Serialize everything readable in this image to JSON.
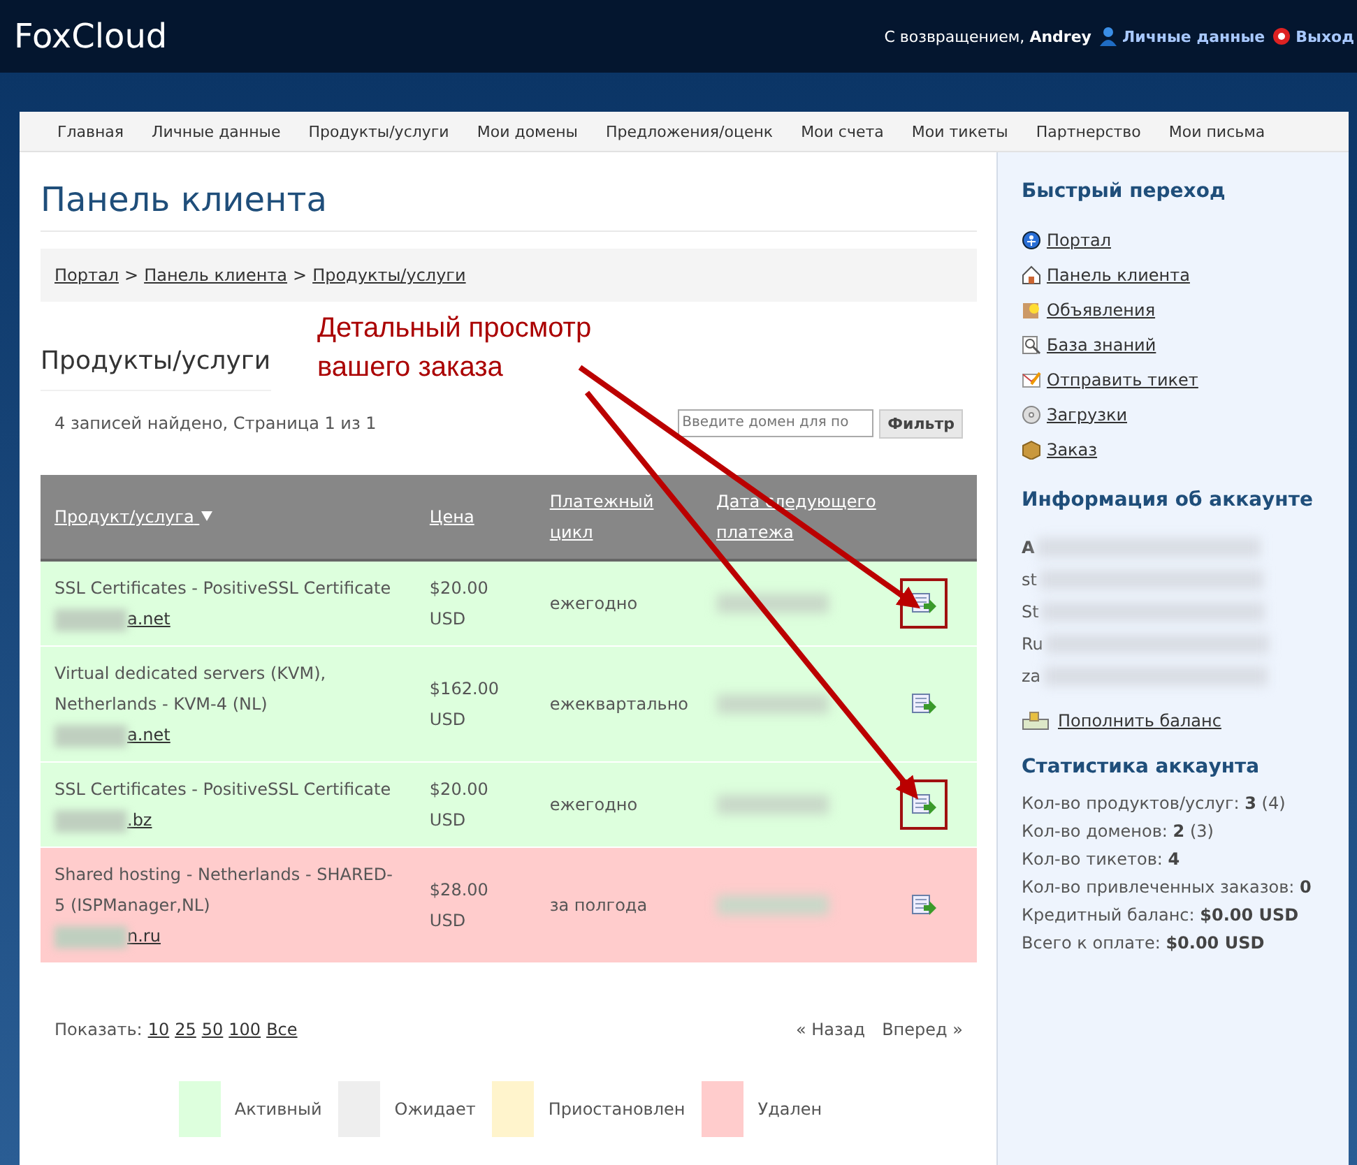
{
  "header": {
    "logo": "FoxCloud",
    "welcome": "С возвращением,",
    "user": "Andrey",
    "links": [
      {
        "label": "Личные данные",
        "kind": "profile"
      },
      {
        "label": "Выход",
        "kind": "logout"
      }
    ]
  },
  "nav": [
    "Главная",
    "Личные данные",
    "Продукты/услуги",
    "Мои домены",
    "Предложения/оценк",
    "Мои счета",
    "Мои тикеты",
    "Партнерство",
    "Мои письма"
  ],
  "page_title": "Панель клиента",
  "breadcrumb": {
    "items": [
      "Портал",
      "Панель клиента",
      "Продукты/услуги"
    ],
    "separator": ">"
  },
  "section_title": "Продукты/услуги",
  "records_info": "4 записей найдено, Страница 1 из 1",
  "filter": {
    "placeholder": "Введите домен для по",
    "button": "Фильтр"
  },
  "table": {
    "columns": [
      {
        "label": "Продукт/услуга",
        "sorted": true
      },
      {
        "label": "Цена",
        "sorted": false
      },
      {
        "label": "Платежный цикл",
        "sorted": false
      },
      {
        "label": "Дата следующего платежа",
        "sorted": false
      }
    ],
    "rows": [
      {
        "product": "SSL Certificates - PositiveSSL Certificate",
        "domain": "a.net",
        "price": "$20.00 USD",
        "cycle": "ежегодно",
        "kind": "active",
        "highlighted": true
      },
      {
        "product": "Virtual dedicated servers (KVM), Netherlands - KVM-4 (NL)",
        "domain": "a.net",
        "price": "$162.00 USD",
        "cycle": "ежеквартально",
        "kind": "active",
        "highlighted": false
      },
      {
        "product": "SSL Certificates - PositiveSSL Certificate",
        "domain": ".bz",
        "price": "$20.00 USD",
        "cycle": "ежегодно",
        "kind": "active",
        "highlighted": true
      },
      {
        "product": "Shared hosting - Netherlands - SHARED-5 (ISPManager,NL)",
        "domain": "n.ru",
        "price": "$28.00 USD",
        "cycle": "за полгода",
        "kind": "deleted",
        "highlighted": false
      }
    ]
  },
  "pagination": {
    "show_label": "Показать:",
    "sizes": [
      "10",
      "25",
      "50",
      "100",
      "Все"
    ],
    "prev": "« Назад",
    "next": "Вперед »"
  },
  "legend": [
    {
      "label": "Активный",
      "color": "#ddffdd"
    },
    {
      "label": "Ожидает",
      "color": "#eeeeee"
    },
    {
      "label": "Приостановлен",
      "color": "#fff4cc"
    },
    {
      "label": "Удален",
      "color": "#ffcccc"
    }
  ],
  "annotation": {
    "text": "Детальный просмотр вашего заказа"
  },
  "sidebar": {
    "quick_title": "Быстрый переход",
    "quick_links": [
      {
        "label": "Портал",
        "kind": "portal"
      },
      {
        "label": "Панель клиента",
        "kind": "home"
      },
      {
        "label": "Объявления",
        "kind": "news"
      },
      {
        "label": "База знаний",
        "kind": "search"
      },
      {
        "label": "Отправить тикет",
        "kind": "ticket"
      },
      {
        "label": "Загрузки",
        "kind": "disc"
      },
      {
        "label": "Заказ",
        "kind": "box"
      }
    ],
    "account_title": "Информация об аккаунте",
    "account_lines": [
      "A",
      "st",
      "St",
      "Ru",
      "za"
    ],
    "topup": "Пополнить баланс",
    "stats_title": "Статистика аккаунта",
    "stats": [
      {
        "label": "Кол-во продуктов/услуг:",
        "value": "3",
        "extra": "(4)"
      },
      {
        "label": "Кол-во доменов:",
        "value": "2",
        "extra": "(3)"
      },
      {
        "label": "Кол-во тикетов:",
        "value": "4"
      },
      {
        "label": "Кол-во привлеченных заказов:",
        "value": "0"
      },
      {
        "label": "Кредитный баланс:",
        "value": "$0.00 USD"
      },
      {
        "label": "Всего к оплате:",
        "value": "$0.00 USD"
      }
    ]
  }
}
